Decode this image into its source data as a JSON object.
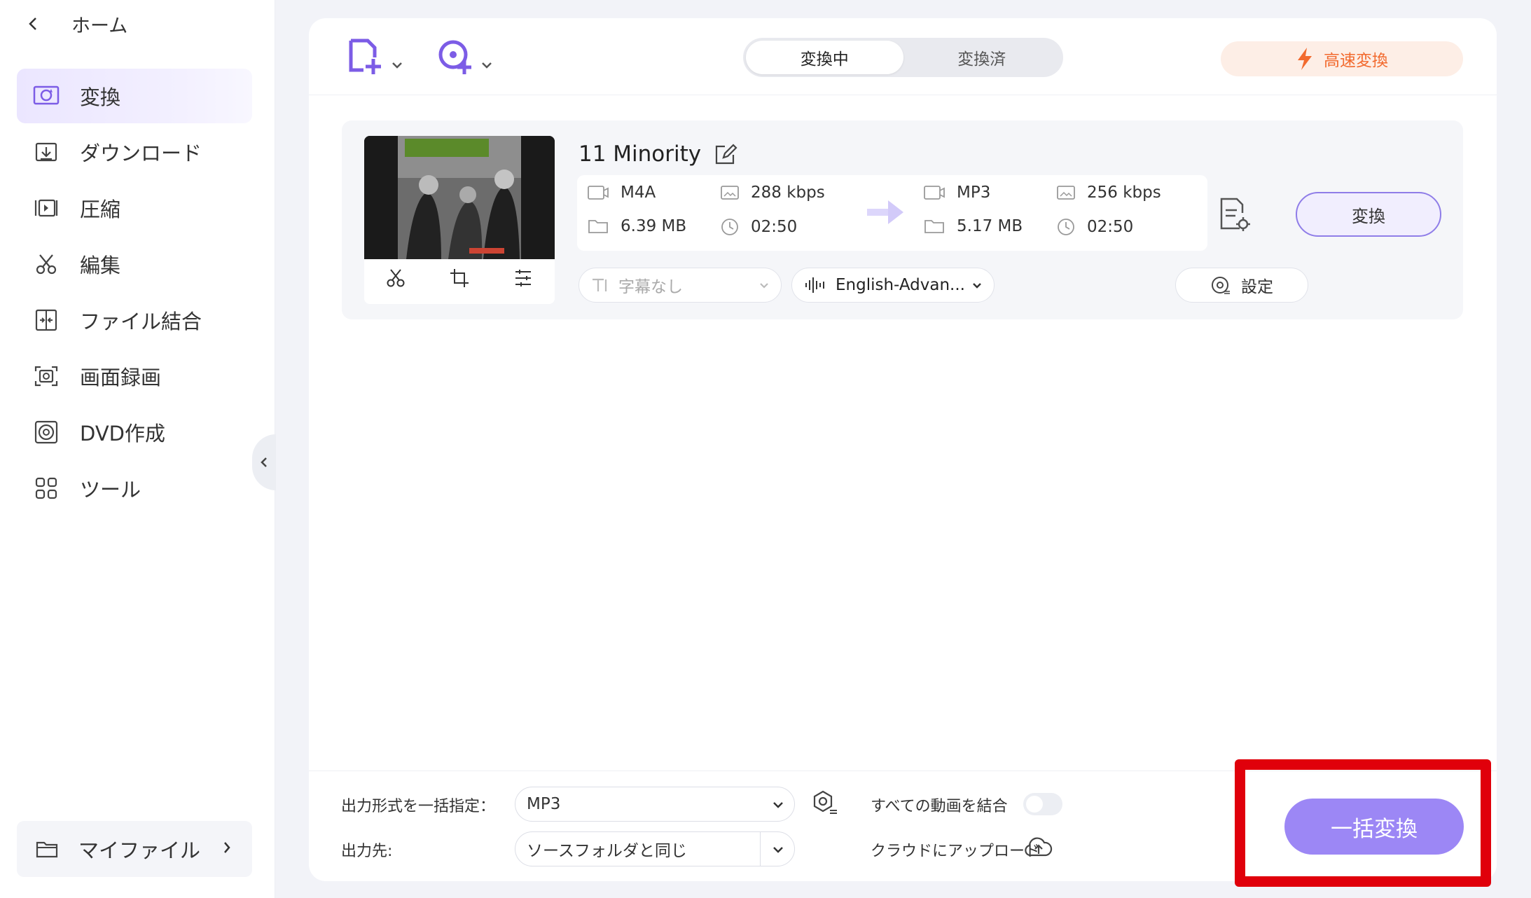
{
  "sidebar": {
    "home_label": "ホーム",
    "items": [
      {
        "label": "変換",
        "icon": "convert-icon",
        "active": true
      },
      {
        "label": "ダウンロード",
        "icon": "download-icon",
        "active": false
      },
      {
        "label": "圧縮",
        "icon": "compress-icon",
        "active": false
      },
      {
        "label": "編集",
        "icon": "scissors-icon",
        "active": false
      },
      {
        "label": "ファイル結合",
        "icon": "merge-icon",
        "active": false
      },
      {
        "label": "画面録画",
        "icon": "screen-record-icon",
        "active": false
      },
      {
        "label": "DVD作成",
        "icon": "dvd-icon",
        "active": false
      },
      {
        "label": "ツール",
        "icon": "tools-icon",
        "active": false
      }
    ],
    "myfiles_label": "マイファイル"
  },
  "toolbar": {
    "tabs": [
      "変換中",
      "変換済"
    ],
    "active_tab": "変換中",
    "fast_label": "高速変換"
  },
  "file": {
    "title": "11 Minority",
    "source": {
      "format": "M4A",
      "bitrate": "288 kbps",
      "size": "6.39 MB",
      "duration": "02:50"
    },
    "target": {
      "format": "MP3",
      "bitrate": "256 kbps",
      "size": "5.17 MB",
      "duration": "02:50"
    },
    "subtitle": "字幕なし",
    "audio_track": "English-Advan...",
    "settings_label": "設定",
    "convert_label": "変換"
  },
  "bottom": {
    "format_label": "出力形式を一括指定：",
    "format_value": "MP3",
    "output_label": "出力先:",
    "output_value": "ソースフォルダと同じ",
    "merge_label": "すべての動画を結合",
    "merge_on": false,
    "upload_label": "クラウドにアップロード",
    "batch_label": "一括変換"
  },
  "colors": {
    "accent": "#9c87f5",
    "fast": "#f26a2e",
    "highlight": "#e0000b"
  }
}
